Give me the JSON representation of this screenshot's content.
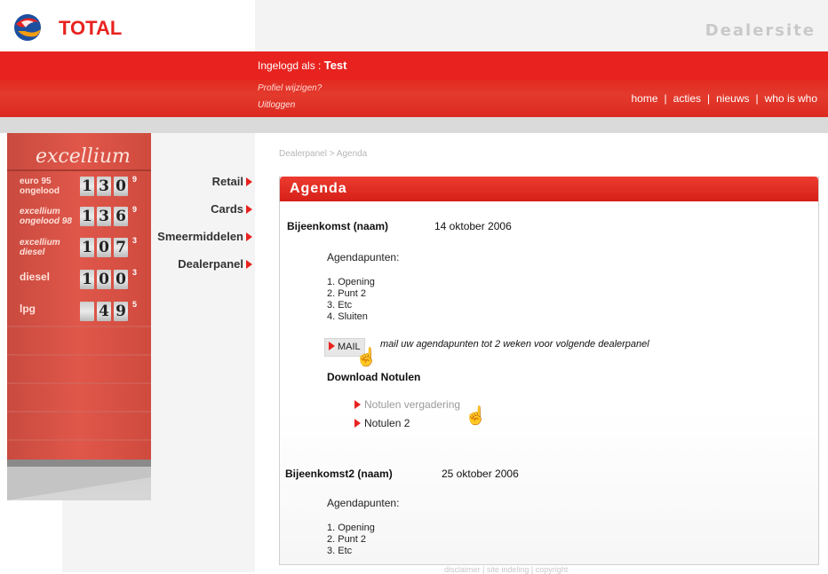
{
  "header": {
    "brand": "TOTAL",
    "site_title": "Dealersite"
  },
  "user_bar": {
    "login_label": "Ingelogd als : ",
    "username": "Test",
    "profile_link": "Profiel wijzigen?",
    "logout_link": "Uitloggen"
  },
  "top_nav": [
    "home",
    "acties",
    "nieuws",
    "who is who"
  ],
  "fuel_prices": [
    {
      "label": "euro 95\nongelood",
      "digits": [
        "1",
        "3",
        "0"
      ],
      "decimal": "9"
    },
    {
      "label": "excellium\nongelood 98",
      "digits": [
        "1",
        "3",
        "6"
      ],
      "decimal": "9"
    },
    {
      "label": "excellium\ndiesel",
      "digits": [
        "1",
        "0",
        "7"
      ],
      "decimal": "3"
    },
    {
      "label": "diesel",
      "digits": [
        "1",
        "0",
        "0"
      ],
      "decimal": "3"
    },
    {
      "label": "lpg",
      "digits": [
        "",
        "4",
        "9"
      ],
      "decimal": "5"
    }
  ],
  "sign_brand": "excellium",
  "side_nav": [
    "Retail",
    "Cards",
    "Smeermiddelen",
    "Dealerpanel"
  ],
  "breadcrumb": "Dealerpanel > Agenda",
  "agenda": {
    "title": "Agenda",
    "meetings": [
      {
        "name": "Bijeenkomst  (naam)",
        "date": "14 oktober 2006",
        "agenda_label": "Agendapunten:",
        "points": [
          "1. Opening",
          "2. Punt 2",
          "3. Etc",
          "4. Sluiten"
        ]
      },
      {
        "name": "Bijeenkomst2  (naam)",
        "date": "25 oktober 2006",
        "agenda_label": "Agendapunten:",
        "points": [
          "1. Opening",
          "2. Punt 2",
          "3. Etc"
        ]
      }
    ],
    "mail_button": "MAIL",
    "mail_note": "mail uw agendapunten tot 2 weken voor volgende dealerpanel",
    "download_title": "Download Notulen",
    "notulen": [
      "Notulen vergadering",
      "Notulen 2"
    ]
  },
  "footer": "disclaimer  |  site indeling  |  copyright",
  "colors": {
    "accent": "#e8231f",
    "muted": "#b6b6b6"
  }
}
